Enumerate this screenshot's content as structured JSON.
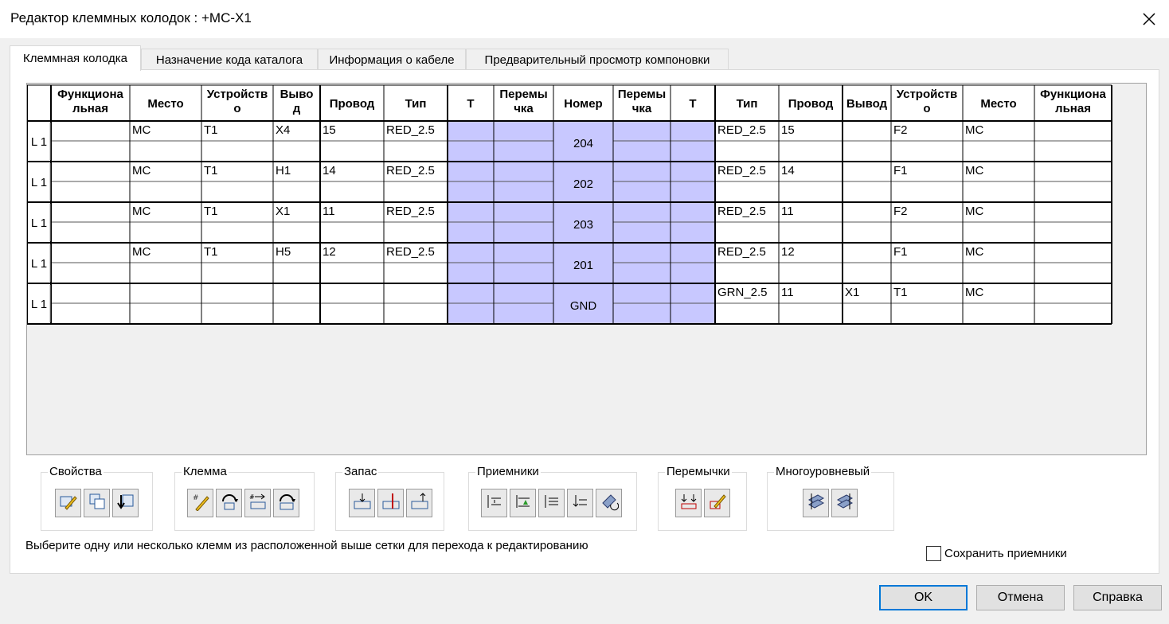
{
  "window": {
    "title": "Редактор клеммных колодок : +MC-X1",
    "close_icon": "close-icon"
  },
  "tabs": [
    {
      "label": "Клеммная колодка",
      "active": true
    },
    {
      "label": "Назначение кода каталога",
      "active": false
    },
    {
      "label": "Информация о кабеле",
      "active": false
    },
    {
      "label": "Предварительный просмотр компоновки",
      "active": false
    }
  ],
  "grid": {
    "headers": [
      [
        "Функциона",
        "льная"
      ],
      [
        "Место"
      ],
      [
        "Устройств",
        "о"
      ],
      [
        "Выво",
        "д"
      ],
      [
        "Провод"
      ],
      [
        "Тип"
      ],
      [
        "Т"
      ],
      [
        "Перемы",
        "чка"
      ],
      [
        "Номер"
      ],
      [
        "Перемы",
        "чка"
      ],
      [
        "Т"
      ],
      [
        "Тип"
      ],
      [
        "Провод"
      ],
      [
        "Вывод"
      ],
      [
        "Устройств",
        "о"
      ],
      [
        "Место"
      ],
      [
        "Функциона",
        "льная"
      ]
    ],
    "rows": [
      {
        "level": "L 1",
        "left": {
          "func": "",
          "place": "MC",
          "device": "T1",
          "pin": "X4",
          "wire": "15",
          "type": "RED_2.5"
        },
        "number": "204",
        "right": {
          "type": "RED_2.5",
          "wire": "15",
          "pin": "",
          "device": "F2",
          "place": "MC",
          "func": ""
        }
      },
      {
        "level": "L 1",
        "left": {
          "func": "",
          "place": "MC",
          "device": "T1",
          "pin": "H1",
          "wire": "14",
          "type": "RED_2.5"
        },
        "number": "202",
        "right": {
          "type": "RED_2.5",
          "wire": "14",
          "pin": "",
          "device": "F1",
          "place": "MC",
          "func": ""
        }
      },
      {
        "level": "L 1",
        "left": {
          "func": "",
          "place": "MC",
          "device": "T1",
          "pin": "X1",
          "wire": "11",
          "type": "RED_2.5"
        },
        "number": "203",
        "right": {
          "type": "RED_2.5",
          "wire": "11",
          "pin": "",
          "device": "F2",
          "place": "MC",
          "func": ""
        }
      },
      {
        "level": "L 1",
        "left": {
          "func": "",
          "place": "MC",
          "device": "T1",
          "pin": "H5",
          "wire": "12",
          "type": "RED_2.5"
        },
        "number": "201",
        "right": {
          "type": "RED_2.5",
          "wire": "12",
          "pin": "",
          "device": "F1",
          "place": "MC",
          "func": ""
        }
      },
      {
        "level": "L 1",
        "left": {
          "func": "",
          "place": "",
          "device": "",
          "pin": "",
          "wire": "",
          "type": ""
        },
        "number": "GND",
        "right": {
          "type": "GRN_2.5",
          "wire": "11",
          "pin": "X1",
          "device": "T1",
          "place": "MC",
          "func": ""
        }
      }
    ]
  },
  "groups": [
    {
      "label": "Свойства",
      "buttons": [
        "edit-properties-icon",
        "copy-properties-icon",
        "paste-properties-icon"
      ]
    },
    {
      "label": "Клемма",
      "buttons": [
        "edit-terminal-icon",
        "move-terminal-icon",
        "renumber-terminal-icon",
        "reverse-terminal-icon"
      ]
    },
    {
      "label": "Запас",
      "buttons": [
        "add-spare-icon",
        "insert-spare-icon",
        "delete-spare-icon"
      ]
    },
    {
      "label": "Приемники",
      "buttons": [
        "move-destinations-icon",
        "add-destinations-icon",
        "swap-destinations-icon",
        "delete-destinations-icon",
        "edit-destinations-icon"
      ]
    },
    {
      "label": "Перемычки",
      "buttons": [
        "add-jumper-icon",
        "edit-jumper-icon"
      ]
    },
    {
      "label": "Многоуровневый",
      "buttons": [
        "multilevel-up-icon",
        "multilevel-down-icon"
      ]
    }
  ],
  "hint": "Выберите одну или несколько клемм из расположенной выше сетки для перехода к редактированию",
  "save_destinations": {
    "label": "Сохранить приемники",
    "checked": false
  },
  "buttons": {
    "ok": "OK",
    "cancel": "Отмена",
    "help": "Справка"
  },
  "colors": {
    "jumper_fill": "#c8c8ff",
    "border": "#000000"
  }
}
